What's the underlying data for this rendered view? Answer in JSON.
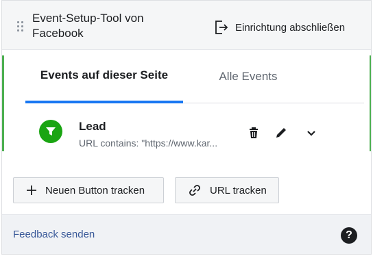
{
  "colors": {
    "accent_blue": "#1877f2",
    "event_icon_green": "#1aa512",
    "link_blue": "#385898",
    "side_accent_green": "#4caf50"
  },
  "header": {
    "title": "Event-Setup-Tool von Facebook",
    "finish_label": "Einrichtung abschließen",
    "icons": [
      "drag-handle-icon",
      "exit-icon"
    ]
  },
  "tabs": [
    {
      "label": "Events auf dieser Seite",
      "active": true
    },
    {
      "label": "Alle Events",
      "active": false
    }
  ],
  "event": {
    "name": "Lead",
    "rule": "URL contains: \"https://www.kar...",
    "icon": "funnel-icon",
    "actions": [
      "trash-icon",
      "pencil-icon",
      "chevron-down-icon"
    ]
  },
  "buttons": {
    "add_button_label": "Neuen Button tracken",
    "url_button_label": "URL tracken"
  },
  "footer": {
    "feedback_label": "Feedback senden",
    "help_symbol": "?"
  }
}
